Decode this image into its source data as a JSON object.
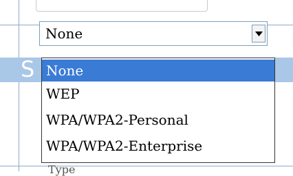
{
  "select": {
    "value": "None",
    "icon": "chevron-down-icon"
  },
  "dropdown": {
    "options": [
      "None",
      "WEP",
      "WPA/WPA2-Personal",
      "WPA/WPA2-Enterprise"
    ],
    "selected_index": 0
  },
  "background": {
    "band_text": "S",
    "bottom_text": "Type"
  },
  "colors": {
    "selection": "#3a7bd5",
    "band": "#a9c7e7"
  }
}
